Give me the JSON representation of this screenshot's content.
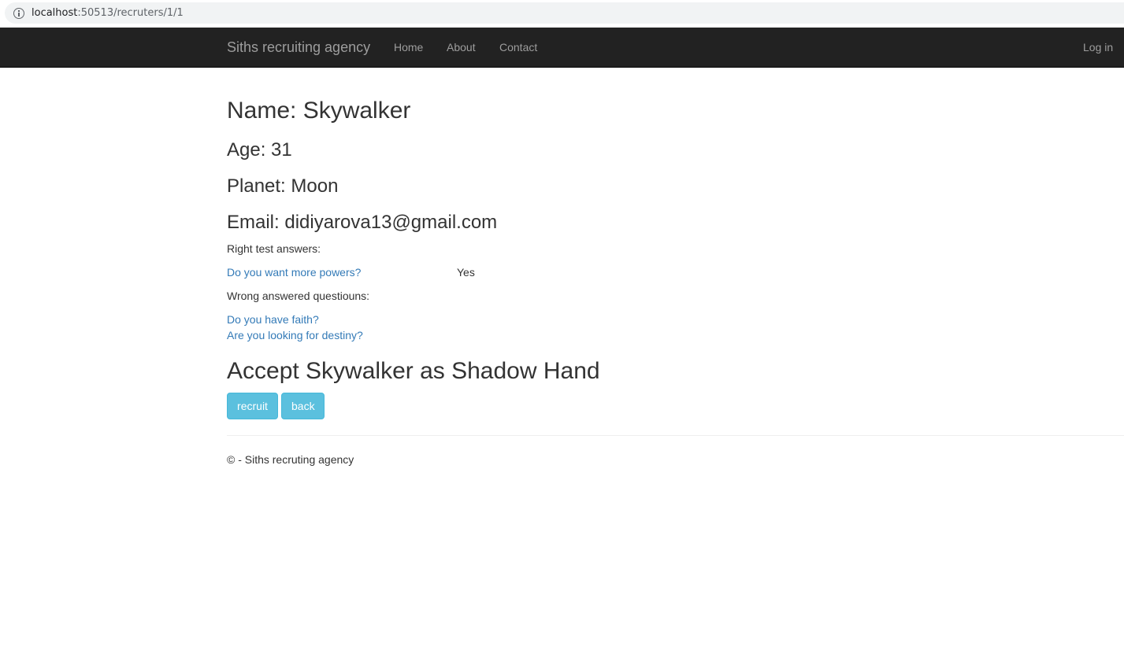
{
  "browser": {
    "url_host": "localhost",
    "url_path": ":50513/recruters/1/1"
  },
  "navbar": {
    "brand": "Siths recruiting agency",
    "links": [
      "Home",
      "About",
      "Contact"
    ],
    "login": "Log in"
  },
  "profile": {
    "name": "Name: Skywalker",
    "age": "Age: 31",
    "planet": "Planet: Moon",
    "email": "Email: didiyarova13@gmail.com"
  },
  "answers": {
    "right_label": "Right test answers:",
    "right": [
      {
        "question": "Do you want more powers?",
        "answer": "Yes"
      }
    ],
    "wrong_label": "Wrong answered questiouns:",
    "wrong": [
      "Do you have faith?",
      "Are you looking for destiny?"
    ]
  },
  "accept": {
    "heading": "Accept Skywalker as Shadow Hand",
    "recruit_label": "recruit",
    "back_label": "back"
  },
  "footer": {
    "text": "© - Siths recruting agency"
  },
  "colors": {
    "navbar_bg": "#222222",
    "link": "#337ab7",
    "button_info": "#5bc0de"
  }
}
